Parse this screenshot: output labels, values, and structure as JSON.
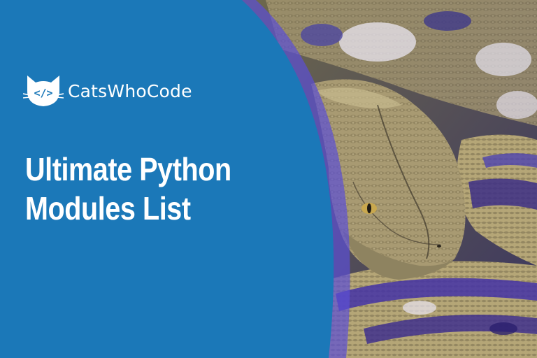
{
  "brand": {
    "name": "CatsWhoCode",
    "logo_text": "</>"
  },
  "headline": {
    "line1": "Ultimate Python",
    "line2": "Modules List"
  },
  "colors": {
    "panel_blue": "#1b78b8",
    "accent_violet": "#5b4fd6",
    "text": "#ffffff"
  }
}
